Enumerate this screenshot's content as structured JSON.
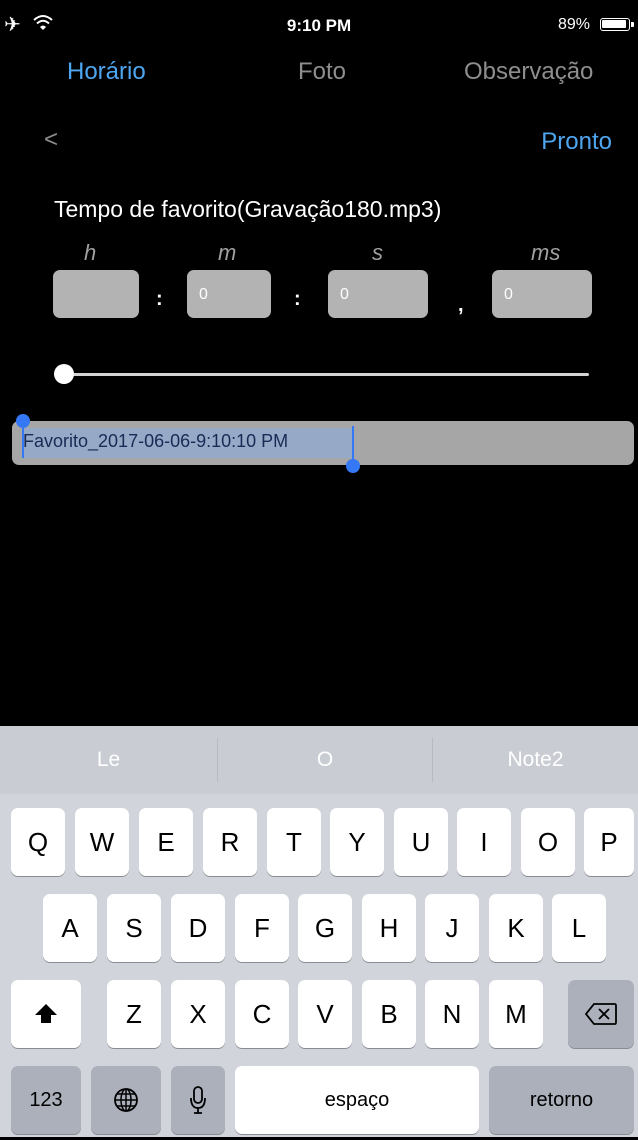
{
  "status_bar": {
    "time": "9:10 PM",
    "battery": "89%"
  },
  "tabs": [
    {
      "label": "Horário",
      "active": true
    },
    {
      "label": "Foto",
      "active": false
    },
    {
      "label": "Observação",
      "active": false
    }
  ],
  "nav": {
    "back": "<",
    "done": "Pronto"
  },
  "editor": {
    "title": "Tempo de favorito(Gravação180.mp3)",
    "units": [
      "h",
      "m",
      "s",
      "ms"
    ],
    "values": {
      "h": "",
      "m": "0",
      "s": "0",
      "ms": "0"
    },
    "separators": [
      ":",
      ":",
      ","
    ],
    "slider_position": 0,
    "name_value": "Favorito_2017-06-06-9:10:10 PM"
  },
  "keyboard": {
    "suggestions": [
      "Le",
      "O",
      "Note2"
    ],
    "row1": [
      "Q",
      "W",
      "E",
      "R",
      "T",
      "Y",
      "U",
      "I",
      "O",
      "P"
    ],
    "row2": [
      "A",
      "S",
      "D",
      "F",
      "G",
      "H",
      "J",
      "K",
      "L"
    ],
    "row3": [
      "Z",
      "X",
      "C",
      "V",
      "B",
      "N",
      "M"
    ],
    "numbers_key": "123",
    "space_key": "espaço",
    "return_key": "retorno",
    "icons": {
      "shift": "shift-icon",
      "delete": "delete-icon",
      "globe": "globe-icon",
      "mic": "mic-icon"
    }
  },
  "colors": {
    "accent": "#4ea6f0",
    "selection": "#3478f6"
  }
}
